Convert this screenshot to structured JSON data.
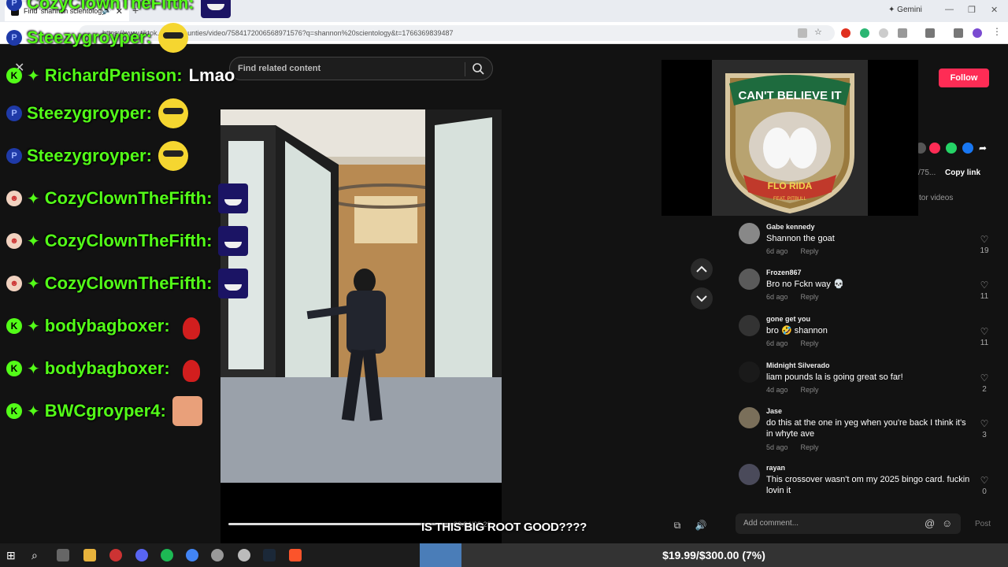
{
  "browser": {
    "tab_title": "Find 'shannon scientology'",
    "url": "https://www.tiktok.com/@...unties/video/7584172006568971576?q=shannon%20scientology&t=1766369839487",
    "gemini_label": "Gemini"
  },
  "page": {
    "search_placeholder": "Find related content",
    "follow_label": "Follow",
    "copy_link_label": "Copy link",
    "url_fragment": "/75...",
    "videos_tab_label": "tor videos",
    "video_time": "00:04/02:29",
    "caption": "IS THIS BIG ROOT GOOD????",
    "patch_title": "CAN'T BELIEVE IT",
    "patch_sub": "FLO RIDA",
    "patch_feat": "FEAT. PITBULL"
  },
  "chat": [
    {
      "badge": "P",
      "badge_type": "p",
      "user": "CozyClownTheFifth:",
      "emote": "clownface",
      "message": ""
    },
    {
      "badge": "P",
      "badge_type": "p",
      "user": "Steezygroyper:",
      "emote": "sun",
      "message": ""
    },
    {
      "badge": "K",
      "badge_type": "k",
      "user": "RichardPenison:",
      "emote": "",
      "message": "Lmao"
    },
    {
      "badge": "P",
      "badge_type": "p",
      "user": "Steezygroyper:",
      "emote": "sun",
      "message": ""
    },
    {
      "badge": "P",
      "badge_type": "p",
      "user": "Steezygroyper:",
      "emote": "sun",
      "message": ""
    },
    {
      "badge": "☻",
      "badge_type": "clown",
      "user": "CozyClownTheFifth:",
      "emote": "clownface",
      "message": ""
    },
    {
      "badge": "☻",
      "badge_type": "clown",
      "user": "CozyClownTheFifth:",
      "emote": "clownface",
      "message": ""
    },
    {
      "badge": "☻",
      "badge_type": "clown",
      "user": "CozyClownTheFifth:",
      "emote": "clownface",
      "message": ""
    },
    {
      "badge": "K",
      "badge_type": "k",
      "user": "bodybagboxer:",
      "emote": "bird",
      "message": ""
    },
    {
      "badge": "K",
      "badge_type": "k",
      "user": "bodybagboxer:",
      "emote": "bird",
      "message": ""
    },
    {
      "badge": "K",
      "badge_type": "k",
      "user": "BWCgroyper4:",
      "emote": "face",
      "message": ""
    }
  ],
  "comments": [
    {
      "user": "Gabe kennedy",
      "text": "Shannon the goat",
      "age": "6d ago",
      "reply": "Reply",
      "likes": "19"
    },
    {
      "user": "Frozen867",
      "text": "Bro no Fckn way 💀",
      "age": "6d ago",
      "reply": "Reply",
      "likes": "11"
    },
    {
      "user": "gone get you",
      "text": "bro 🤣 shannon",
      "age": "6d ago",
      "reply": "Reply",
      "likes": "11"
    },
    {
      "user": "Midnight Silverado",
      "text": "liam pounds la is going great so far!",
      "age": "4d ago",
      "reply": "Reply",
      "likes": "2"
    },
    {
      "user": "Jase",
      "text": "do this at the one in yeg when you're back I think it's in whyte ave",
      "age": "5d ago",
      "reply": "Reply",
      "likes": "3"
    },
    {
      "user": "rayan",
      "text": "This crossover wasn't om my 2025 bingo card. fuckin lovin it",
      "age": "",
      "reply": "",
      "likes": "0"
    }
  ],
  "comment_input": {
    "placeholder": "Add comment...",
    "post_label": "Post"
  },
  "donation": {
    "text": "$19.99/$300.00 (7%)",
    "progress_fraction": 0.07
  },
  "colors": {
    "follow": "#fe2c55",
    "kick_green": "#53fc18",
    "donation_fill": "#4a7db8"
  }
}
